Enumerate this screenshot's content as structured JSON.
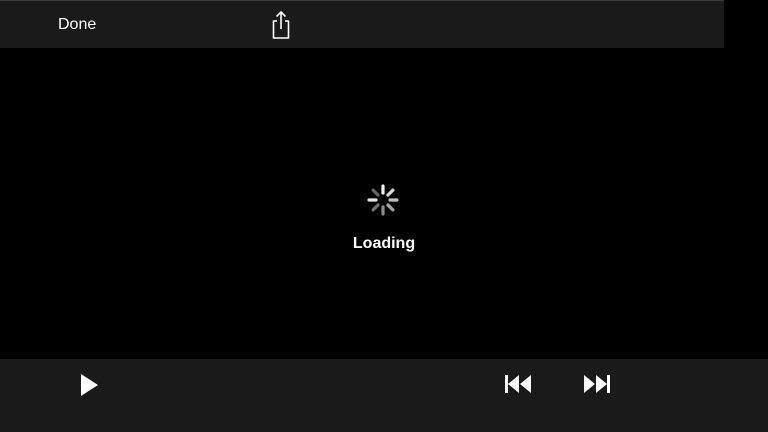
{
  "top_bar": {
    "done_label": "Done",
    "share_icon": "share-icon"
  },
  "player": {
    "status_label": "Loading",
    "spinner_icon": "loading-spinner-icon"
  },
  "controls": {
    "play_icon": "play-icon",
    "rewind_icon": "skip-back-icon",
    "forward_icon": "skip-forward-icon"
  },
  "colors": {
    "background": "#000000",
    "bar": "#1a1a1a",
    "text": "#ffffff"
  }
}
